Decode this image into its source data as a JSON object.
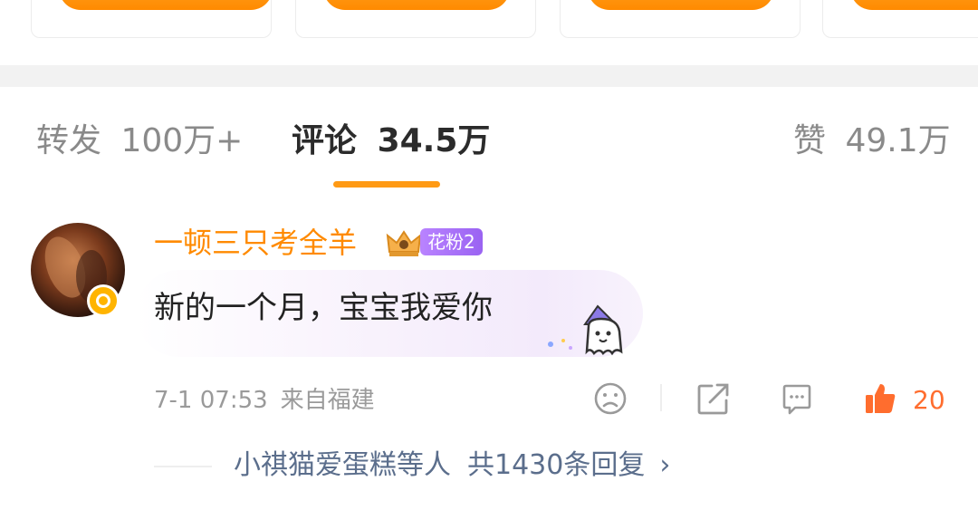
{
  "tabs": {
    "repost": {
      "label": "转发",
      "count": "100万+"
    },
    "comments": {
      "label": "评论",
      "count": "34.5万"
    },
    "likes": {
      "label": "赞",
      "count": "49.1万"
    }
  },
  "comment": {
    "username": "一顿三只考全羊",
    "fan_badge": "花粉2",
    "text": "新的一个月，宝宝我爱你",
    "time": "7-1 07:53",
    "location": "来自福建",
    "like_count": "20",
    "reply_summary": "小祺猫爱蛋糕等人",
    "reply_count": "共1430条回复",
    "icons": [
      "sad-face-icon",
      "share-icon",
      "comment-icon",
      "thumbs-up-icon",
      "chevron-right-icon",
      "crown-icon",
      "ghost-sticker-icon",
      "verified-badge-icon"
    ]
  },
  "colors": {
    "accent": "#ff8a00",
    "tab_underline": "#ff9a14",
    "like": "#ff6d2e",
    "reply_link": "#5b6e8c",
    "fan_badge": "#a46cf5"
  }
}
